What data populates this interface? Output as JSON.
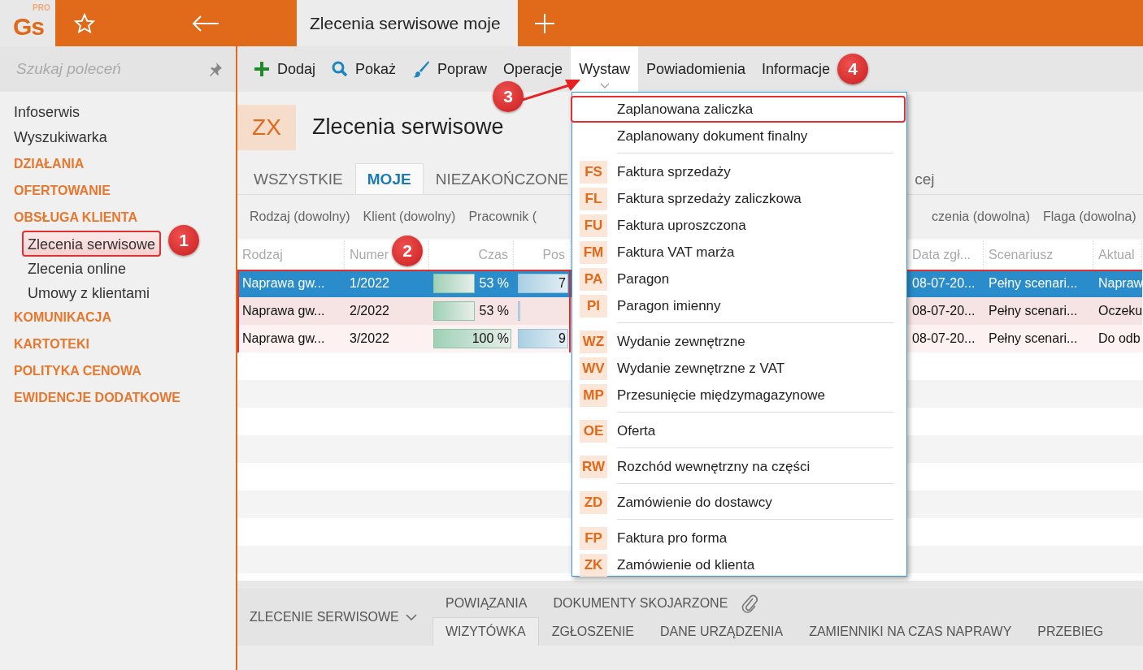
{
  "topbar": {
    "logo": "Gs",
    "logo_badge": "PRO",
    "tab_title": "Zlecenia serwisowe moje"
  },
  "sidebar": {
    "search": {
      "placeholder": "Szukaj poleceń"
    },
    "items": [
      {
        "kind": "link",
        "label": "Infoserwis"
      },
      {
        "kind": "link",
        "label": "Wyszukiwarka"
      },
      {
        "kind": "section",
        "label": "DZIAŁANIA"
      },
      {
        "kind": "section",
        "label": "OFERTOWANIE"
      },
      {
        "kind": "section",
        "label": "OBSŁUGA KLIENTA",
        "children": [
          {
            "label": "Zlecenia serwisowe",
            "selected": true,
            "highlighted": true
          },
          {
            "label": "Zlecenia online",
            "selected": false,
            "highlighted": false
          },
          {
            "label": "Umowy z klientami",
            "selected": false,
            "highlighted": false
          }
        ]
      },
      {
        "kind": "section",
        "label": "KOMUNIKACJA"
      },
      {
        "kind": "section",
        "label": "KARTOTEKI"
      },
      {
        "kind": "section",
        "label": "POLITYKA CENOWA"
      },
      {
        "kind": "section",
        "label": "EWIDENCJE DODATKOWE"
      }
    ]
  },
  "toolbar": [
    {
      "kind": "add",
      "label": "Dodaj",
      "selected": false
    },
    {
      "kind": "search",
      "label": "Pokaż",
      "selected": false
    },
    {
      "kind": "edit",
      "label": "Popraw",
      "selected": false
    },
    {
      "kind": "text",
      "label": "Operacje",
      "selected": false
    },
    {
      "kind": "text",
      "label": "Wystaw",
      "selected": true
    },
    {
      "kind": "text",
      "label": "Powiadomienia",
      "selected": false
    },
    {
      "kind": "text",
      "label": "Informacje",
      "selected": false
    }
  ],
  "header": {
    "code": "ZX",
    "title": "Zlecenia serwisowe"
  },
  "tabs": [
    {
      "label": "WSZYSTKIE",
      "selected": false
    },
    {
      "label": "MOJE",
      "selected": true
    },
    {
      "label": "NIEZAKOŃCZONE",
      "selected": false
    },
    {
      "label": "cej",
      "selected": false
    }
  ],
  "filters": [
    "Rodzaj (dowolny)",
    "Klient (dowolny)",
    "Pracownik (",
    "czenia (dowolna)",
    "Flaga (dowolna)"
  ],
  "table": {
    "columns": [
      {
        "label": "Rodzaj",
        "kind": "text"
      },
      {
        "label": "Numer",
        "kind": "text"
      },
      {
        "label": "Czas",
        "kind": "bar"
      },
      {
        "label": "Pos",
        "kind": "bar"
      },
      {
        "label": "Data zgł...",
        "kind": "text"
      },
      {
        "label": "Scenariusz",
        "kind": "text"
      },
      {
        "label": "Aktual",
        "kind": "text"
      }
    ],
    "rows": [
      {
        "selected": true,
        "highlighted": true,
        "cells": [
          "Naprawa gw...",
          "1/2022",
          {
            "text": "53 %",
            "level": 0.53
          },
          {
            "text": "7",
            "level": 1
          },
          "08-07-20...",
          "Pełny scenari...",
          "Napraw"
        ]
      },
      {
        "selected": false,
        "highlighted": true,
        "cells": [
          "Naprawa gw...",
          "2/2022",
          {
            "text": "53 %",
            "level": 0.53
          },
          {
            "text": "",
            "level": 0.05
          },
          "08-07-20...",
          "Pełny scenari...",
          "Oczeku"
        ]
      },
      {
        "selected": false,
        "highlighted": true,
        "cells": [
          "Naprawa gw...",
          "3/2022",
          {
            "text": "100 %",
            "level": 1
          },
          {
            "text": "9",
            "level": 1
          },
          "08-07-20...",
          "Pełny scenari...",
          "Do odb"
        ]
      }
    ]
  },
  "menu": {
    "sections": [
      {
        "items": [
          {
            "label": "Zaplanowana zaliczka",
            "highlighted": true
          },
          {
            "label": "Zaplanowany dokument finalny",
            "highlighted": false
          }
        ]
      },
      {
        "items": [
          {
            "code": "FS",
            "label": "Faktura sprzedaży",
            "highlighted": false
          },
          {
            "code": "FL",
            "label": "Faktura sprzedaży zaliczkowa",
            "highlighted": false
          },
          {
            "code": "FU",
            "label": "Faktura uproszczona",
            "highlighted": false
          },
          {
            "code": "FM",
            "label": "Faktura VAT marża",
            "highlighted": false
          },
          {
            "code": "PA",
            "label": "Paragon",
            "highlighted": false
          },
          {
            "code": "PI",
            "label": "Paragon imienny",
            "highlighted": false
          }
        ]
      },
      {
        "items": [
          {
            "code": "WZ",
            "label": "Wydanie zewnętrzne",
            "highlighted": false
          },
          {
            "code": "WV",
            "label": "Wydanie zewnętrzne z VAT",
            "highlighted": false
          },
          {
            "code": "MP",
            "label": "Przesunięcie międzymagazynowe",
            "highlighted": false
          }
        ]
      },
      {
        "items": [
          {
            "code": "OE",
            "label": "Oferta",
            "highlighted": false
          }
        ]
      },
      {
        "items": [
          {
            "code": "RW",
            "label": "Rozchód wewnętrzny na części",
            "highlighted": false
          }
        ]
      },
      {
        "items": [
          {
            "code": "ZD",
            "label": "Zamówienie do dostawcy",
            "highlighted": false
          }
        ]
      },
      {
        "items": [
          {
            "code": "FP",
            "label": "Faktura pro forma",
            "highlighted": false
          },
          {
            "code": "ZK",
            "label": "Zamówienie od klienta",
            "highlighted": false
          }
        ]
      }
    ]
  },
  "bottom_panel": {
    "title": "ZLECENIE SERWISOWE",
    "tabs_top": [
      "POWIĄZANIA",
      "DOKUMENTY SKOJARZONE"
    ],
    "tabs": [
      {
        "label": "WIZYTÓWKA",
        "selected": true
      },
      {
        "label": "ZGŁOSZENIE",
        "selected": false
      },
      {
        "label": "DANE URZĄDZENIA",
        "selected": false
      },
      {
        "label": "ZAMIENNIKI NA CZAS NAPRAWY",
        "selected": false
      },
      {
        "label": "PRZEBIEG",
        "selected": false
      }
    ]
  },
  "annotations": [
    {
      "label": "1"
    },
    {
      "label": "2"
    },
    {
      "label": "3"
    },
    {
      "label": "4"
    }
  ]
}
